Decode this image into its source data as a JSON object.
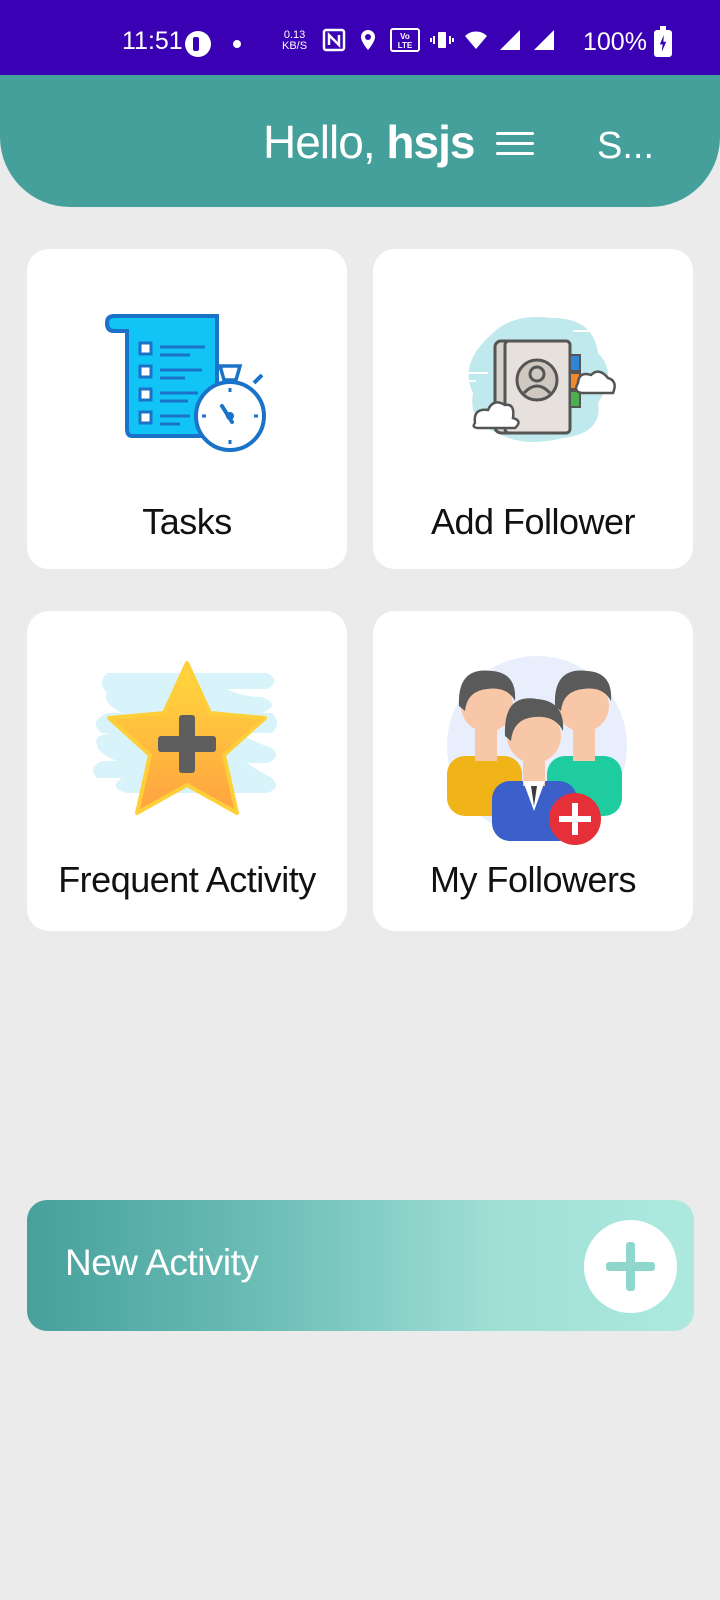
{
  "status_bar": {
    "time": "11:51",
    "speed_value": "0.13",
    "speed_unit": "KB/S",
    "battery": "100%"
  },
  "header": {
    "greeting_prefix": "Hello, ",
    "username": "hsjs",
    "trailing_text": "S..."
  },
  "cards": [
    {
      "label": "Tasks",
      "icon": "task-list-stopwatch-icon"
    },
    {
      "label": "Add Follower",
      "icon": "contact-book-icon"
    },
    {
      "label": "Frequent Activity",
      "icon": "star-plus-icon"
    },
    {
      "label": "My Followers",
      "icon": "group-add-icon"
    }
  ],
  "new_activity": {
    "label": "New Activity"
  },
  "colors": {
    "status_bar": "#3a00b3",
    "header": "#45a09c",
    "background": "#ebebeb",
    "accent_light": "#ade9df"
  }
}
